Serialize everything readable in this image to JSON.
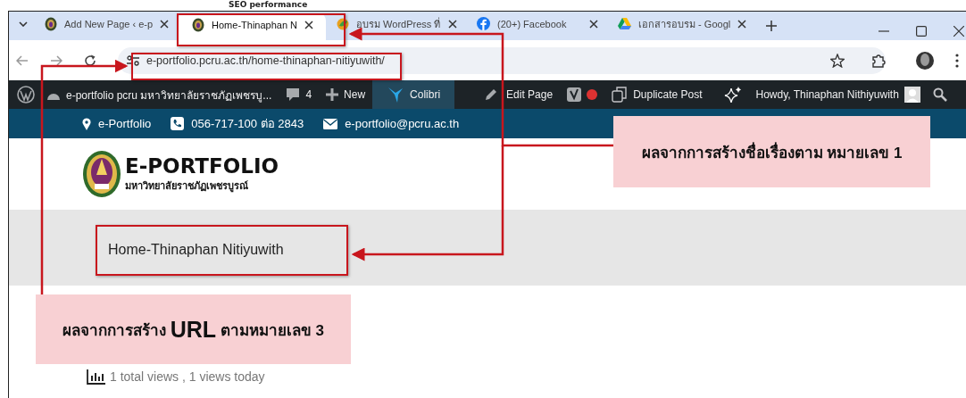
{
  "background_document": {
    "heading": "SEO performance"
  },
  "browser": {
    "tabs": [
      {
        "kind": "seal",
        "title": "Add New Page ‹ e-p",
        "selected": false
      },
      {
        "kind": "seal",
        "title": "Home-Thinaphan N",
        "selected": true
      },
      {
        "kind": "leaf",
        "title": "อบรม WordPress ที่",
        "selected": false
      },
      {
        "kind": "fcircle",
        "title": "(20+) Facebook",
        "selected": false
      },
      {
        "kind": "triangle",
        "title": "เอกสารอบรม - Googl",
        "selected": false
      }
    ],
    "url": "e-portfolio.pcru.ac.th/home-thinaphan-nitiyuwith/"
  },
  "admin_bar": {
    "site_name": "e-portfolio pcru มหาวิทยาลัยราชภัฏเพชรบู...",
    "comments": "4",
    "new_label": "New",
    "builder_label": "Colibri",
    "edit_label": "Edit Page",
    "duplicate_label": "Duplicate Post",
    "greeting": "Howdy, Thinaphan Nithiyuwith"
  },
  "contact_bar": {
    "location": "e-Portfolio",
    "phone": "056-717-100 ต่อ 2843",
    "email": "e-portfolio@pcru.ac.th"
  },
  "site_header": {
    "logo_title": "E-PORTFOLIO",
    "logo_subtitle": "มหาวิทยาลัยราชภัฏเพชรบูรณ์"
  },
  "page_title": "Home-Thinaphan Nitiyuwith",
  "post_stats": "1 total views , 1 views today",
  "annotations": [
    {
      "kind": "title",
      "parts": [
        {
          "text": "ผลจากการสร้างชื่อเรื่องตาม หมายเลข 1",
          "large": false
        }
      ]
    },
    {
      "kind": "url",
      "parts": [
        {
          "text": "ผลจากการสร้าง ",
          "large": false
        },
        {
          "text": "URL",
          "large": true
        },
        {
          "text": " ตามหมายเลข 3",
          "large": false
        }
      ]
    }
  ]
}
